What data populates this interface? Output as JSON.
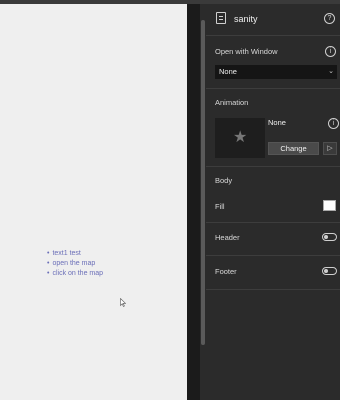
{
  "canvas": {
    "bullets": [
      "text1 test",
      "open the map",
      "click on the map"
    ]
  },
  "panel": {
    "title": "sanity",
    "help_glyph": "?",
    "open_with_window": {
      "label": "Open with Window",
      "info_glyph": "i",
      "selected": "None",
      "chevron": "⌄"
    },
    "animation": {
      "label": "Animation",
      "name": "None",
      "info_glyph": "i",
      "change_label": "Change",
      "play_glyph": "▷",
      "preview_icon": "★"
    },
    "body": {
      "label": "Body",
      "fill_label": "Fill",
      "fill_color": "#ffffff"
    },
    "header": {
      "label": "Header",
      "enabled": false
    },
    "footer": {
      "label": "Footer",
      "enabled": false
    }
  }
}
